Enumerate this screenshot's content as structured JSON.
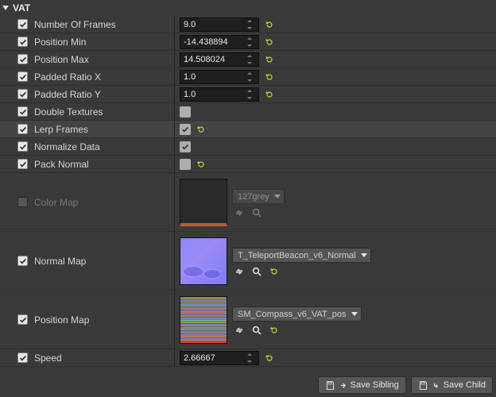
{
  "category": {
    "title": "VAT"
  },
  "props": {
    "numFrames": {
      "label": "Number Of Frames",
      "value": "9.0"
    },
    "posMin": {
      "label": "Position Min",
      "value": "-14.438894"
    },
    "posMax": {
      "label": "Position Max",
      "value": "14.508024"
    },
    "padX": {
      "label": "Padded Ratio X",
      "value": "1.0"
    },
    "padY": {
      "label": "Padded Ratio Y",
      "value": "1.0"
    },
    "doubleTex": {
      "label": "Double Textures"
    },
    "lerpFrames": {
      "label": "Lerp Frames"
    },
    "normData": {
      "label": "Normalize Data"
    },
    "packNormal": {
      "label": "Pack Normal"
    },
    "colorMap": {
      "label": "Color Map",
      "asset": "127grey"
    },
    "normalMap": {
      "label": "Normal Map",
      "asset": "T_TeleportBeacon_v6_Normal"
    },
    "positionMap": {
      "label": "Position Map",
      "asset": "SM_Compass_v6_VAT_pos"
    },
    "speed": {
      "label": "Speed",
      "value": "2.66667"
    }
  },
  "footer": {
    "saveSibling": "Save Sibling",
    "saveChild": "Save Child"
  }
}
